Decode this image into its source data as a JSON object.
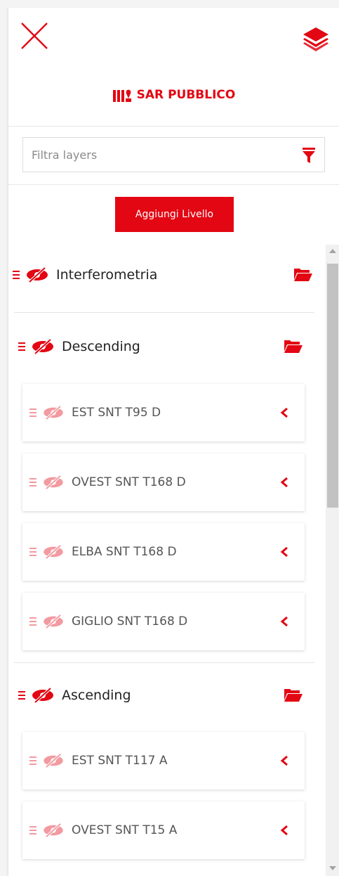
{
  "panel": {
    "title": "SAR PUBBLICO",
    "filter": {
      "placeholder": "Filtra layers",
      "value": ""
    },
    "add_button_label": "Aggiungi Livello"
  },
  "icons": {
    "close": "close-icon",
    "layers": "layers-icon",
    "title": "map-layers-icon",
    "filter": "filter-icon",
    "drag": "drag-handle-icon",
    "visibility": "eye-slash-icon",
    "folder": "folder-open-icon",
    "expand": "chevron-left-icon"
  },
  "colors": {
    "accent": "#e30613",
    "accent_light": "#f29aa0",
    "text": "#222222",
    "muted_text": "#555555"
  },
  "tree": {
    "root": {
      "label": "Interferometria"
    },
    "groups": [
      {
        "label": "Descending",
        "layers": [
          {
            "label": "EST SNT T95 D"
          },
          {
            "label": "OVEST SNT T168 D"
          },
          {
            "label": "ELBA SNT T168 D"
          },
          {
            "label": "GIGLIO SNT T168 D"
          }
        ]
      },
      {
        "label": "Ascending",
        "layers": [
          {
            "label": "EST SNT T117 A"
          },
          {
            "label": "OVEST SNT T15 A"
          }
        ]
      }
    ]
  }
}
